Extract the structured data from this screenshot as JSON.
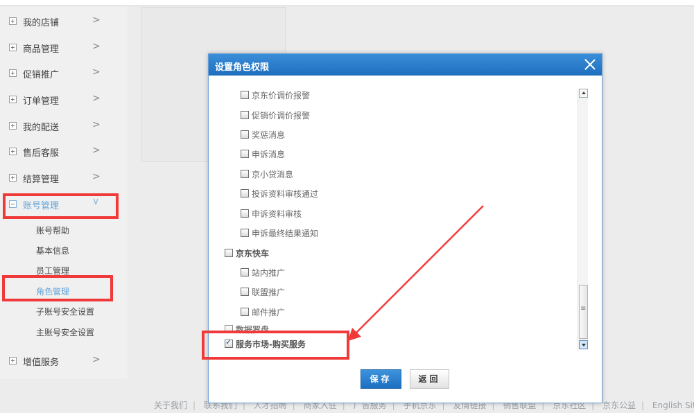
{
  "sidebar": {
    "items": [
      {
        "label": "我的店铺"
      },
      {
        "label": "商品管理"
      },
      {
        "label": "促销推广"
      },
      {
        "label": "订单管理"
      },
      {
        "label": "我的配送"
      },
      {
        "label": "售后客服"
      },
      {
        "label": "结算管理"
      },
      {
        "label": "账号管理"
      },
      {
        "label": "增值服务"
      }
    ],
    "sub_items": [
      {
        "label": "账号帮助"
      },
      {
        "label": "基本信息"
      },
      {
        "label": "员工管理"
      },
      {
        "label": "角色管理"
      },
      {
        "label": "子账号安全设置"
      },
      {
        "label": "主账号安全设置"
      }
    ],
    "chevron_right": ">",
    "chevron_down": "∨"
  },
  "modal": {
    "title": "设置角色权限",
    "permissions": [
      {
        "label": "京东价调价报警",
        "checked": false,
        "group": false
      },
      {
        "label": "促销价调价报警",
        "checked": false,
        "group": false
      },
      {
        "label": "奖惩消息",
        "checked": false,
        "group": false
      },
      {
        "label": "申诉消息",
        "checked": false,
        "group": false
      },
      {
        "label": "京小贷消息",
        "checked": false,
        "group": false
      },
      {
        "label": "投诉资料审核通过",
        "checked": false,
        "group": false
      },
      {
        "label": "申诉资料审核",
        "checked": false,
        "group": false
      },
      {
        "label": "申诉最终结果通知",
        "checked": false,
        "group": false
      },
      {
        "label": "京东快车",
        "checked": false,
        "group": true
      },
      {
        "label": "站内推广",
        "checked": false,
        "group": false
      },
      {
        "label": "联盟推广",
        "checked": false,
        "group": false
      },
      {
        "label": "邮件推广",
        "checked": false,
        "group": false
      },
      {
        "label": "数据罗盘",
        "checked": false,
        "group": true
      },
      {
        "label": "服务市场-购买服务",
        "checked": true,
        "group": true
      }
    ],
    "save_label": "保存",
    "back_label": "返回"
  },
  "footer": {
    "links": [
      "关于我们",
      "联系我们",
      "人才招聘",
      "商家入驻",
      "广告服务",
      "手机京东",
      "友情链接",
      "销售联盟",
      "京东社区",
      "京东公益",
      "English Site"
    ]
  },
  "colors": {
    "accent": "#1f6fbf",
    "highlight": "#f03a3a",
    "active_nav": "#62a3d8"
  }
}
